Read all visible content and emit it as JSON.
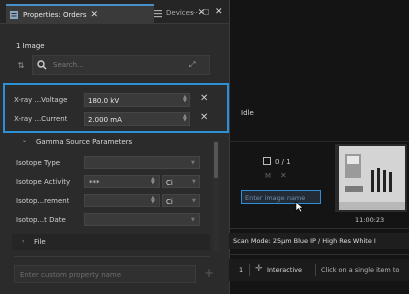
{
  "tabs": [
    {
      "label": "Properties: Orders",
      "icon": "properties-icon"
    },
    {
      "label": "Devices",
      "icon": "devices-icon"
    }
  ],
  "window_controls": {
    "more": "⋯",
    "restore": "◻",
    "close": "✕"
  },
  "selection_text": "1 Image",
  "search": {
    "placeholder": "Search..."
  },
  "xray": [
    {
      "label": "X-ray ...Voltage",
      "value": "180.0 kV"
    },
    {
      "label": "X-ray ...Current",
      "value": "2.000 mA"
    }
  ],
  "gamma_section": {
    "label": "Gamma Source Parameters"
  },
  "gamma_rows": [
    {
      "label": "Isotope Type",
      "value": "",
      "unit": ""
    },
    {
      "label": "Isotope Activity",
      "value": "***",
      "unit": "Ci"
    },
    {
      "label": "Isotop...rement",
      "value": "",
      "unit": "Ci"
    },
    {
      "label": "Isotop...t Date",
      "value": "",
      "unit": ""
    }
  ],
  "file_section": {
    "label": "File"
  },
  "custom_property": {
    "placeholder": "Enter custom property name"
  },
  "right": {
    "status": "Idle",
    "counter": "0 / 1",
    "image_name_placeholder": "Enter image name",
    "timestamp": "11:00:23",
    "scan_mode": "Scan Mode:  25µm Blue IP / High Res White I",
    "bottom": {
      "index": "1",
      "interactive": "Interactive",
      "hint": "Click on a single item to"
    }
  },
  "colors": {
    "accent": "#2e8fd6",
    "tab_active_border": "#4a90c8",
    "panel": "#2b2b2b",
    "viewer": "#141414"
  }
}
